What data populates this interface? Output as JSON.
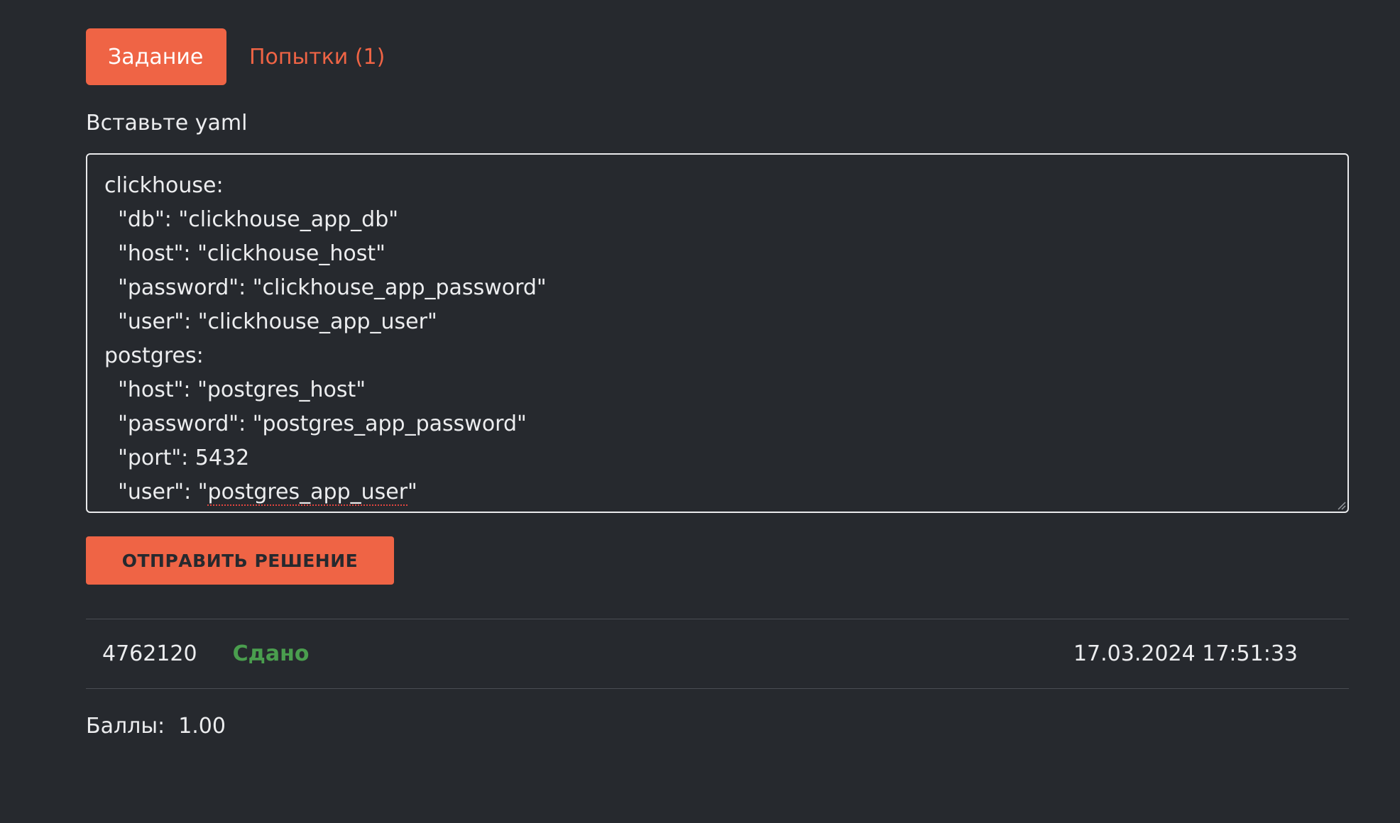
{
  "tabs": {
    "task_label": "Задание",
    "attempts_label": "Попытки (1)"
  },
  "editor": {
    "label": "Вставьте yaml",
    "lines": [
      "clickhouse:",
      "  \"db\": \"clickhouse_app_db\"",
      "  \"host\": \"clickhouse_host\"",
      "  \"password\": \"clickhouse_app_password\"",
      "  \"user\": \"clickhouse_app_user\"",
      "postgres:",
      "  \"host\": \"postgres_host\"",
      "  \"password\": \"postgres_app_password\"",
      "  \"port\": 5432"
    ],
    "last_line_prefix": "  \"user\": \"",
    "last_line_flagged": "postgres_app_user",
    "last_line_suffix": "\""
  },
  "submit": {
    "label": "ОТПРАВИТЬ РЕШЕНИЕ"
  },
  "attempt": {
    "id": "4762120",
    "status": "Сдано",
    "timestamp": "17.03.2024 17:51:33"
  },
  "score": {
    "label": "Баллы:",
    "value": "1.00"
  },
  "colors": {
    "accent": "#ef6445",
    "background": "#26292e",
    "success": "#4a9e4e"
  }
}
